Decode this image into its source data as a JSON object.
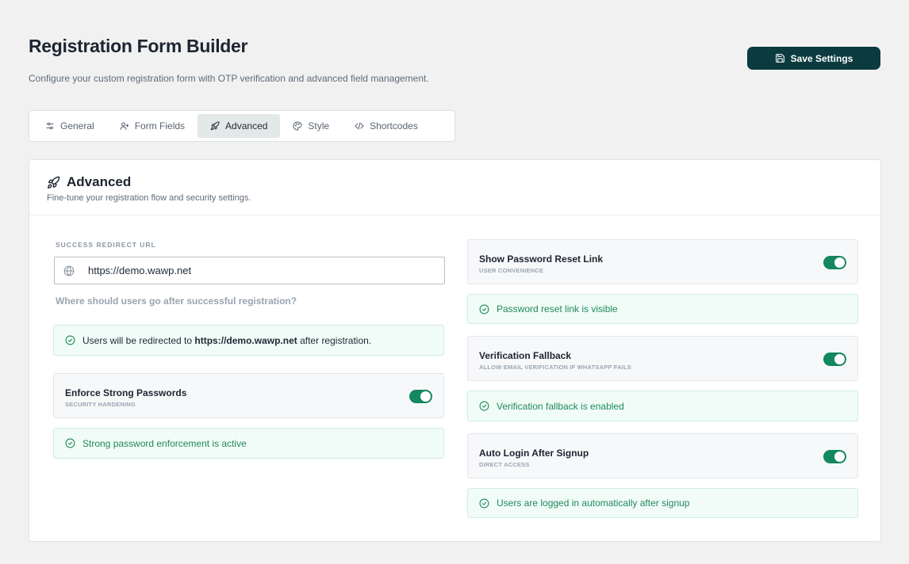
{
  "header": {
    "title": "Registration Form Builder",
    "subtitle": "Configure your custom registration form with OTP verification and advanced field management.",
    "save_label": "Save Settings"
  },
  "tabs": [
    {
      "label": "General",
      "icon": "sliders-icon",
      "active": false
    },
    {
      "label": "Form Fields",
      "icon": "user-plus-icon",
      "active": false
    },
    {
      "label": "Advanced",
      "icon": "rocket-icon",
      "active": true
    },
    {
      "label": "Style",
      "icon": "palette-icon",
      "active": false
    },
    {
      "label": "Shortcodes",
      "icon": "code-icon",
      "active": false
    }
  ],
  "panel": {
    "title": "Advanced",
    "description": "Fine-tune your registration flow and security settings."
  },
  "redirect": {
    "label": "SUCCESS REDIRECT URL",
    "value": "https://demo.wawp.net",
    "hint": "Where should users go after successful registration?",
    "notice_prefix": "Users will be redirected to",
    "notice_url": "https://demo.wawp.net",
    "notice_suffix": "after registration."
  },
  "strong_passwords": {
    "title": "Enforce Strong Passwords",
    "subtitle": "SECURITY HARDENING",
    "enabled": true,
    "status": "Strong password enforcement is active"
  },
  "password_reset": {
    "title": "Show Password Reset Link",
    "subtitle": "USER CONVENIENCE",
    "enabled": true,
    "status": "Password reset link is visible"
  },
  "verification_fallback": {
    "title": "Verification Fallback",
    "subtitle": "ALLOW EMAIL VERIFICATION IF WHATSAPP FAILS",
    "enabled": true,
    "status": "Verification fallback is enabled"
  },
  "auto_login": {
    "title": "Auto Login After Signup",
    "subtitle": "DIRECT ACCESS",
    "enabled": true,
    "status": "Users are logged in automatically after signup"
  },
  "colors": {
    "primary_button": "#0b3b3f",
    "toggle_on": "#13875f",
    "success_text": "#1f8a5c",
    "success_bg": "#f1fbf7",
    "page_bg": "#f1f1f1"
  }
}
